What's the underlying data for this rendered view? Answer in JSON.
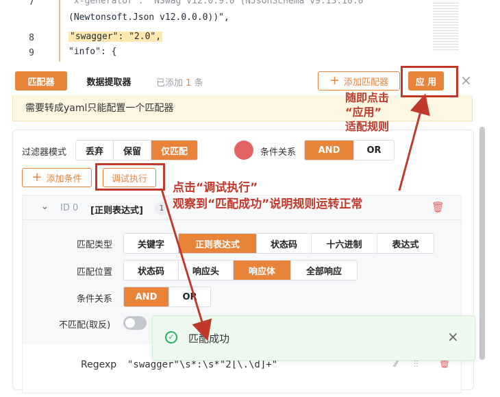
{
  "code": {
    "line7_num": "7",
    "line7_text": "\"x-generator\": \"NSwag v12.0.9.0 (NJsonSchema v9.13.10.0",
    "line7b_text": "(Newtonsoft.Json v12.0.0.0))\",",
    "line8_num": "8",
    "line8_key": "\"swagger\": \"2.0\",",
    "line9_num": "9",
    "line9_text": "\"info\": {"
  },
  "toolbar": {
    "tab_matcher": "匹配器",
    "tab_extractor": "数据提取器",
    "added_prefix": "已添加",
    "added_count": "1",
    "added_suffix": "条",
    "add_matcher": "添加匹配器",
    "apply": "应 用",
    "close": "×"
  },
  "notice": "需要转成yaml只能配置一个匹配器",
  "filter": {
    "mode_label": "过滤器模式",
    "modes": [
      "丢弃",
      "保留",
      "仅匹配"
    ],
    "cond_label": "条件关系",
    "cond_options": [
      "AND",
      "OR"
    ],
    "add_condition": "添加条件",
    "debug_run": "调试执行"
  },
  "rule": {
    "id_label": "ID 0",
    "type_name": "[正则表达式]",
    "count": "1",
    "match_type_label": "匹配类型",
    "match_types": [
      "关键字",
      "正则表达式",
      "状态码",
      "十六进制",
      "表达式"
    ],
    "match_pos_label": "匹配位置",
    "match_positions": [
      "状态码",
      "响应头",
      "响应体",
      "全部响应"
    ],
    "cond_label": "条件关系",
    "cond_options": [
      "AND",
      "OR"
    ],
    "negate_label": "不匹配(取反)",
    "regexp_label": "Regexp",
    "regexp_value": "\"swagger\"\\s*:\\s*\"2[\\.\\d]+\""
  },
  "toast": {
    "message": "匹配成功",
    "close": "×"
  },
  "annotations": {
    "apply_note_1": "随即点击",
    "apply_note_2": "“应用”",
    "apply_note_3": "适配规则",
    "debug_note_1": "点击“调试执行”",
    "debug_note_2": "观察到“匹配成功”说明规则运转正常"
  },
  "colors": {
    "accent": "#e8833a",
    "annotation": "#c0392b",
    "success": "#27ae60"
  }
}
